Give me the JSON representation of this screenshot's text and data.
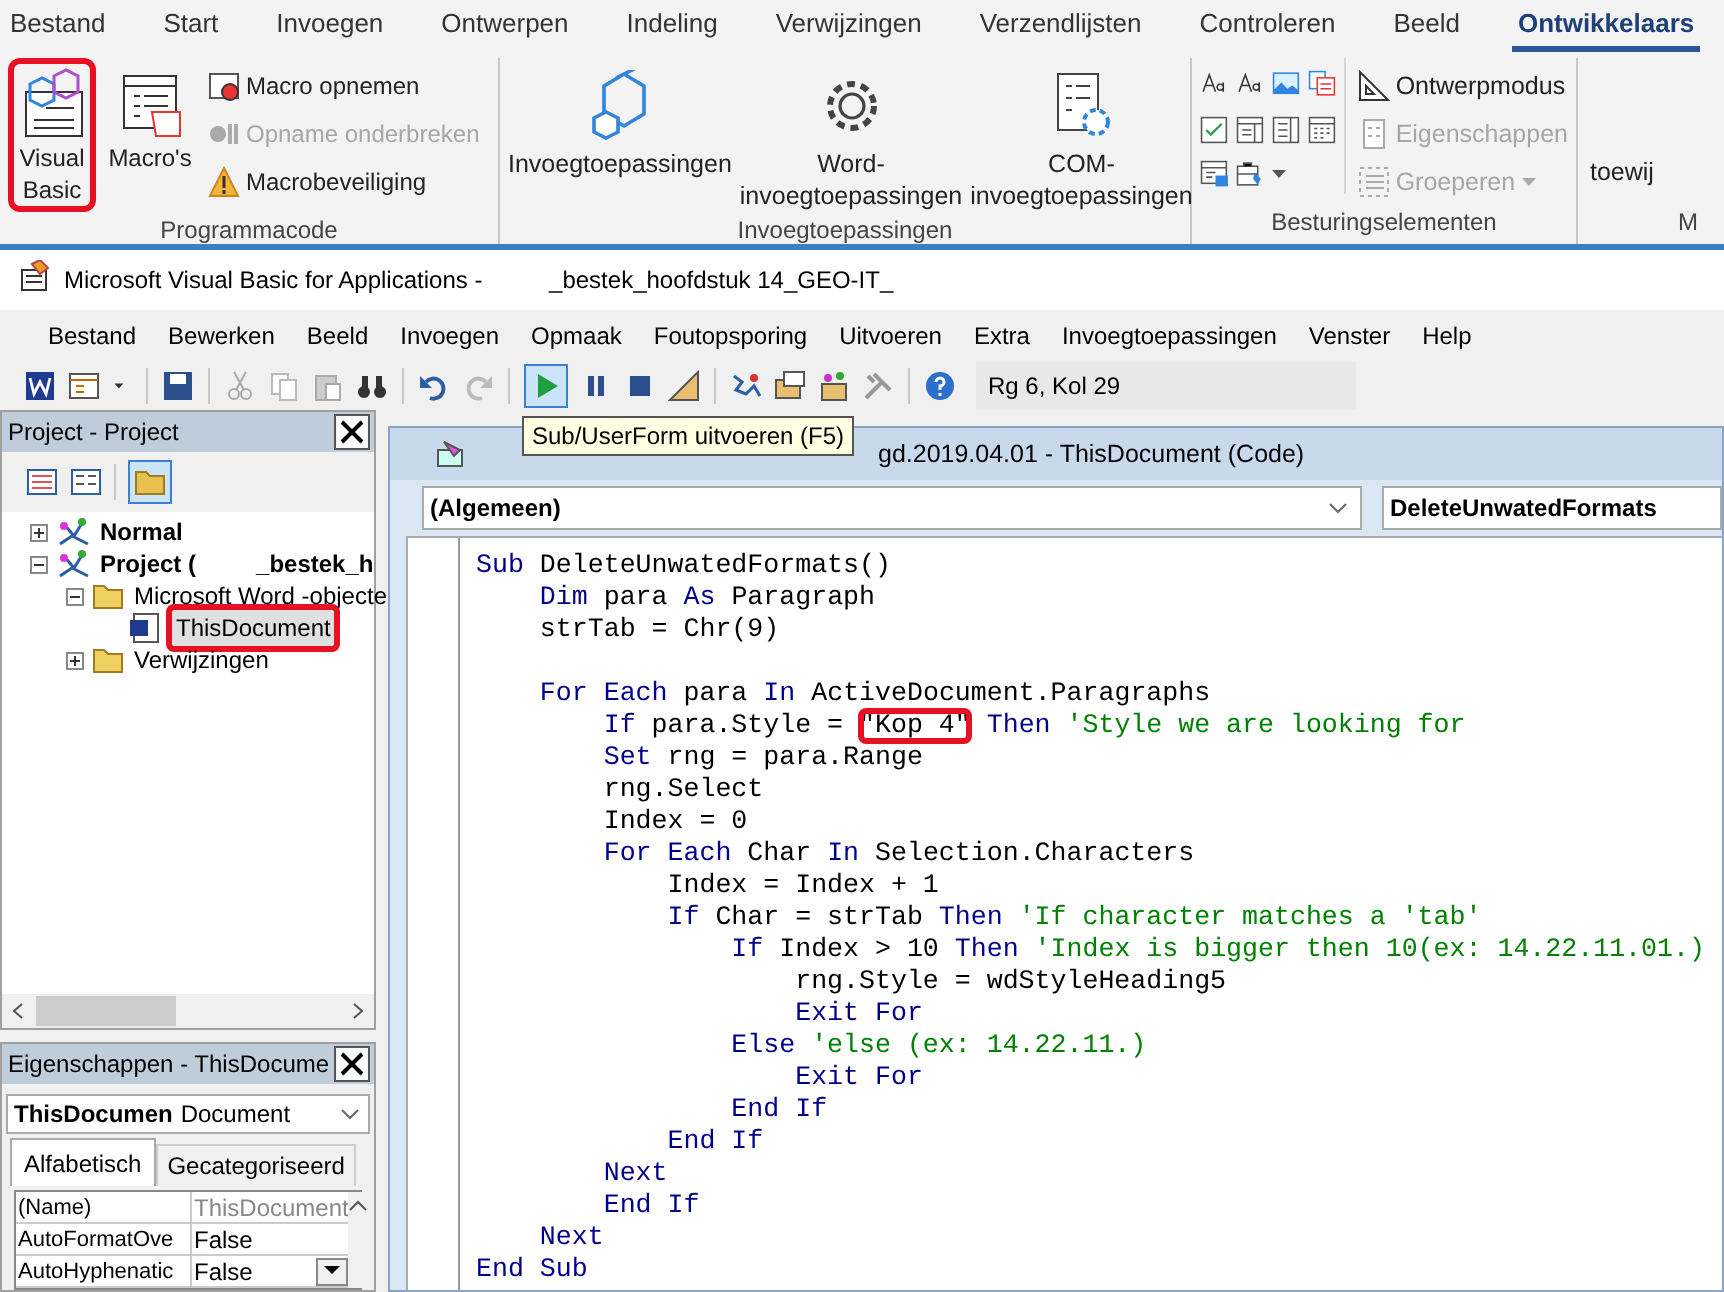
{
  "ribbon": {
    "tabs": [
      {
        "label": "Bestand",
        "selected": false
      },
      {
        "label": "Start",
        "selected": false
      },
      {
        "label": "Invoegen",
        "selected": false
      },
      {
        "label": "Ontwerpen",
        "selected": false
      },
      {
        "label": "Indeling",
        "selected": false
      },
      {
        "label": "Verwijzingen",
        "selected": false
      },
      {
        "label": "Verzendlijsten",
        "selected": false
      },
      {
        "label": "Controleren",
        "selected": false
      },
      {
        "label": "Beeld",
        "selected": false
      },
      {
        "label": "Ontwikkelaars",
        "selected": true
      }
    ],
    "programmacode": {
      "label": "Programmacode",
      "large_buttons": [
        {
          "label": "Visual Basic",
          "highlighted": true
        },
        {
          "label": "Macro's",
          "highlighted": false
        }
      ],
      "small_buttons": [
        {
          "label": "Macro opnemen",
          "disabled": false
        },
        {
          "label": "Opname onderbreken",
          "disabled": true
        },
        {
          "label": "Macrobeveiliging",
          "disabled": false
        }
      ]
    },
    "invoegtoepassingen": {
      "label": "Invoegtoepassingen",
      "buttons": [
        {
          "label": "Invoegtoepassingen"
        },
        {
          "label": "Word-\ninvoegtoepassingen"
        },
        {
          "label": "COM-\ninvoegtoepassingen"
        }
      ]
    },
    "besturingselementen": {
      "label": "Besturingselementen",
      "buttons": [
        {
          "label": "Ontwerpmodus",
          "disabled": false
        },
        {
          "label": "Eigenschappen",
          "disabled": true
        },
        {
          "label": "Groeperen",
          "disabled": true
        }
      ]
    },
    "cut_group": {
      "button": "toewij",
      "label": "M"
    }
  },
  "vba": {
    "title": "Microsoft Visual Basic for Applications -          _bestek_hoofdstuk 14_GEO-IT_",
    "menu": [
      "Bestand",
      "Bewerken",
      "Beeld",
      "Invoegen",
      "Opmaak",
      "Foutopsporing",
      "Uitvoeren",
      "Extra",
      "Invoegtoepassingen",
      "Venster",
      "Help"
    ],
    "position": "Rg 6, Kol 29",
    "tooltip": "Sub/UserForm uitvoeren (F5)",
    "project": {
      "title": "Project - Project",
      "tree": [
        {
          "label": "Normal",
          "expanded": false,
          "selected": false,
          "highlighted": false
        },
        {
          "label": "Project (         _bestek_h",
          "expanded": true,
          "selected": false,
          "highlighted": false,
          "children": [
            {
              "label": "Microsoft Word -objecte",
              "expanded": true,
              "selected": false,
              "highlighted": false,
              "children": [
                {
                  "label": "ThisDocument",
                  "selected": true,
                  "highlighted": true
                }
              ]
            },
            {
              "label": "Verwijzingen",
              "expanded": false,
              "selected": false,
              "highlighted": false
            }
          ]
        }
      ]
    },
    "properties": {
      "title": "Eigenschappen - ThisDocume",
      "object": "ThisDocumen",
      "object_type": "Document",
      "tabs": [
        {
          "label": "Alfabetisch",
          "selected": true
        },
        {
          "label": "Gecategoriseerd",
          "selected": false
        }
      ],
      "rows": [
        {
          "name": "(Name)",
          "value": "ThisDocument",
          "selected": false
        },
        {
          "name": "AutoFormatOve",
          "value": "False",
          "selected": false
        },
        {
          "name": "AutoHyphenatic",
          "value": "False",
          "selected": true
        }
      ]
    },
    "code_window": {
      "title": "gd.2019.04.01 - ThisDocument (Code)",
      "object_combo": "(Algemeen)",
      "procedure_combo": "DeleteUnwatedFormats",
      "lines": [
        {
          "segments": [
            {
              "kind": "keyword",
              "text": "Sub"
            },
            {
              "kind": "plain",
              "text": " DeleteUnwatedFormats()"
            }
          ]
        },
        {
          "segments": [
            {
              "kind": "keyword",
              "text": "    Dim"
            },
            {
              "kind": "plain",
              "text": " para "
            },
            {
              "kind": "keyword",
              "text": "As"
            },
            {
              "kind": "plain",
              "text": " Paragraph"
            }
          ]
        },
        {
          "segments": [
            {
              "kind": "plain",
              "text": "    strTab = Chr(9)"
            }
          ]
        },
        {
          "blank": true
        },
        {
          "segments": [
            {
              "kind": "keyword",
              "text": "    For Each"
            },
            {
              "kind": "plain",
              "text": " para "
            },
            {
              "kind": "keyword",
              "text": "In"
            },
            {
              "kind": "plain",
              "text": " ActiveDocument.Paragraphs"
            }
          ]
        },
        {
          "segments": [
            {
              "kind": "keyword",
              "text": "        If"
            },
            {
              "kind": "plain",
              "text": " para.Style = "
            },
            {
              "kind": "plain",
              "text": "\"Kop 4\"",
              "highlighted": true
            },
            {
              "kind": "keyword",
              "text": " Then"
            },
            {
              "kind": "comment",
              "text": " 'Style we are looking for"
            }
          ]
        },
        {
          "segments": [
            {
              "kind": "keyword",
              "text": "        Set"
            },
            {
              "kind": "plain",
              "text": " rng = para.Range"
            }
          ]
        },
        {
          "segments": [
            {
              "kind": "plain",
              "text": "        rng.Select"
            }
          ]
        },
        {
          "segments": [
            {
              "kind": "plain",
              "text": "        Index = 0"
            }
          ]
        },
        {
          "segments": [
            {
              "kind": "keyword",
              "text": "        For Each"
            },
            {
              "kind": "plain",
              "text": " Char "
            },
            {
              "kind": "keyword",
              "text": "In"
            },
            {
              "kind": "plain",
              "text": " Selection.Characters"
            }
          ]
        },
        {
          "segments": [
            {
              "kind": "plain",
              "text": "            Index = Index + 1"
            }
          ]
        },
        {
          "segments": [
            {
              "kind": "keyword",
              "text": "            If"
            },
            {
              "kind": "plain",
              "text": " Char = strTab "
            },
            {
              "kind": "keyword",
              "text": "Then"
            },
            {
              "kind": "comment",
              "text": " 'If character matches a 'tab'"
            }
          ]
        },
        {
          "segments": [
            {
              "kind": "keyword",
              "text": "                If"
            },
            {
              "kind": "plain",
              "text": " Index > 10 "
            },
            {
              "kind": "keyword",
              "text": "Then"
            },
            {
              "kind": "comment",
              "text": " 'Index is bigger then 10(ex: 14.22.11.01.)"
            }
          ]
        },
        {
          "segments": [
            {
              "kind": "plain",
              "text": "                    rng.Style = wdStyleHeading5"
            }
          ]
        },
        {
          "segments": [
            {
              "kind": "keyword",
              "text": "                    Exit For"
            }
          ]
        },
        {
          "segments": [
            {
              "kind": "keyword",
              "text": "                Else"
            },
            {
              "kind": "comment",
              "text": " 'else (ex: 14.22.11.)"
            }
          ]
        },
        {
          "segments": [
            {
              "kind": "keyword",
              "text": "                    Exit For"
            }
          ]
        },
        {
          "segments": [
            {
              "kind": "keyword",
              "text": "                End If"
            }
          ]
        },
        {
          "segments": [
            {
              "kind": "keyword",
              "text": "            End If"
            }
          ]
        },
        {
          "segments": [
            {
              "kind": "keyword",
              "text": "        Next"
            }
          ]
        },
        {
          "segments": [
            {
              "kind": "keyword",
              "text": "        End If"
            }
          ]
        },
        {
          "segments": [
            {
              "kind": "keyword",
              "text": "    Next"
            }
          ]
        },
        {
          "segments": [
            {
              "kind": "keyword",
              "text": "End Sub"
            }
          ]
        }
      ]
    }
  }
}
